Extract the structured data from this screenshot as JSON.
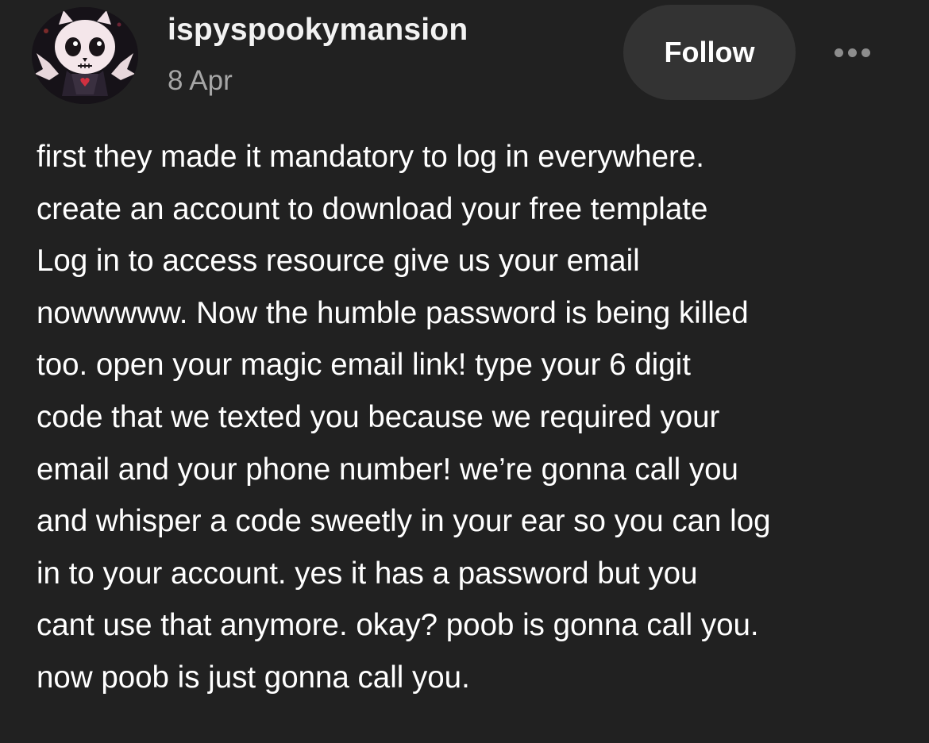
{
  "post": {
    "username": "ispyspookymansion",
    "date": "8 Apr",
    "follow_label": "Follow",
    "more_icon": "more-horizontal-icon",
    "avatar_icon": "skull-avatar",
    "body_lines": [
      "first they made it mandatory to log in everywhere.",
      "create an account to download your free template",
      "Log in to access resource give us your email",
      "nowwwww. Now the humble password is being killed",
      "too. open your magic email link! type your 6 digit",
      "code that we texted you because we required your",
      "email and your phone number! we’re gonna call you",
      "and whisper a code sweetly in your ear so you can log",
      "in to your account. yes it has a password but you",
      "cant use that anymore. okay? poob is gonna call you.",
      "now poob is just gonna call you."
    ]
  },
  "colors": {
    "background": "#212121",
    "text": "#ffffff",
    "secondary_text": "#a6a6a6",
    "button_bg": "#333333"
  }
}
